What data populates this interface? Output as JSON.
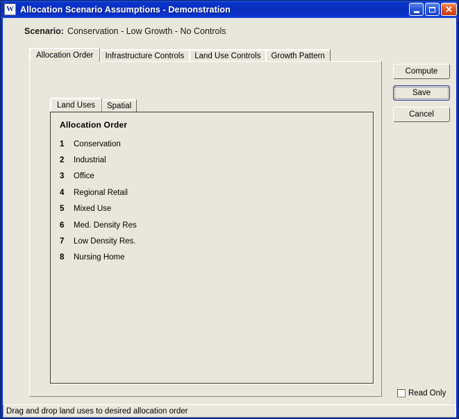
{
  "window": {
    "title": "Allocation Scenario Assumptions - Demonstration",
    "icon": "W",
    "icon_name": "word-document-icon",
    "controls": {
      "minimize_label": "_",
      "maximize_label": "",
      "close_label": "✕"
    },
    "frame_color": "#0a246a",
    "titlebar_color": "#0a2ec0",
    "client_color": "#e9e7db"
  },
  "scenario": {
    "label": "Scenario:",
    "value": "Conservation - Low Growth - No Controls"
  },
  "outer_tabs": [
    {
      "label": "Allocation Order",
      "active": true
    },
    {
      "label": "Infrastructure Controls",
      "active": false
    },
    {
      "label": "Land Use Controls",
      "active": false
    },
    {
      "label": "Growth Pattern",
      "active": false
    }
  ],
  "inner_tabs": [
    {
      "label": "Land Uses",
      "active": true
    },
    {
      "label": "Spatial",
      "active": false
    }
  ],
  "allocation": {
    "heading": "Allocation Order",
    "items": [
      {
        "num": "1",
        "label": "Conservation"
      },
      {
        "num": "2",
        "label": "Industrial"
      },
      {
        "num": "3",
        "label": "Office"
      },
      {
        "num": "4",
        "label": "Regional Retail"
      },
      {
        "num": "5",
        "label": "Mixed Use"
      },
      {
        "num": "6",
        "label": "Med. Density Res"
      },
      {
        "num": "7",
        "label": "Low Density Res."
      },
      {
        "num": "8",
        "label": "Nursing Home"
      }
    ]
  },
  "buttons": {
    "compute": "Compute",
    "save": "Save",
    "cancel": "Cancel",
    "focused": "Save"
  },
  "readonly": {
    "label": "Read Only",
    "checked": false
  },
  "statusbar": {
    "message": "Drag and drop land uses to desired allocation order"
  }
}
